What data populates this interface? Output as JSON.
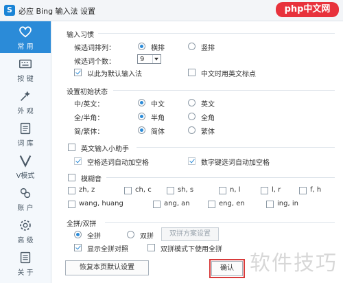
{
  "titlebar": {
    "logo": "S",
    "title": "必应 Bing 输入法 设置",
    "watermark_logo": "php中文网"
  },
  "sidebar": {
    "items": [
      {
        "label": "常 用",
        "icon": "heart-icon",
        "active": true
      },
      {
        "label": "按 键",
        "icon": "keyboard-icon"
      },
      {
        "label": "外 观",
        "icon": "palette-icon"
      },
      {
        "label": "词 库",
        "icon": "book-icon"
      },
      {
        "label": "V模式",
        "icon": "v-letter-icon"
      },
      {
        "label": "账 户",
        "icon": "user-icon"
      },
      {
        "label": "高 级",
        "icon": "gear-icon"
      },
      {
        "label": "关 于",
        "icon": "info-icon"
      }
    ]
  },
  "input_habit": {
    "title": "输入习惯",
    "arrangement_label": "候选词排列：",
    "horizontal": "横排",
    "vertical": "竖排",
    "count_label": "候选词个数：",
    "count_value": "9",
    "default_ime": "以此为默认输入法",
    "english_punct": "中文时用英文标点"
  },
  "init_state": {
    "title": "设置初始状态",
    "cn_en_label": "中/英文：",
    "cn": "中文",
    "en": "英文",
    "width_label": "全/半角：",
    "half": "半角",
    "full": "全角",
    "script_label": "简/繁体：",
    "simplified": "简体",
    "traditional": "繁体"
  },
  "english_helper": {
    "title": "英文输入小助手",
    "auto_space": "空格选词自动加空格",
    "digit_space": "数字键选词自动加空格"
  },
  "fuzzy": {
    "title": "模糊音",
    "pairs": [
      "zh, z",
      "ch, c",
      "sh, s",
      "n, l",
      "l, r",
      "f, h",
      "wang, huang",
      "ang, an",
      "eng, en",
      "ing, in"
    ]
  },
  "pinyin": {
    "title": "全拼/双拼",
    "full": "全拼",
    "double": "双拼",
    "scheme_button": "双拼方案设置",
    "show_full": "显示全拼对照",
    "double_use_full": "双拼模式下使用全拼"
  },
  "footer": {
    "restore": "恢复本页默认设置",
    "confirm": "确认"
  },
  "watermark": "软件技巧"
}
